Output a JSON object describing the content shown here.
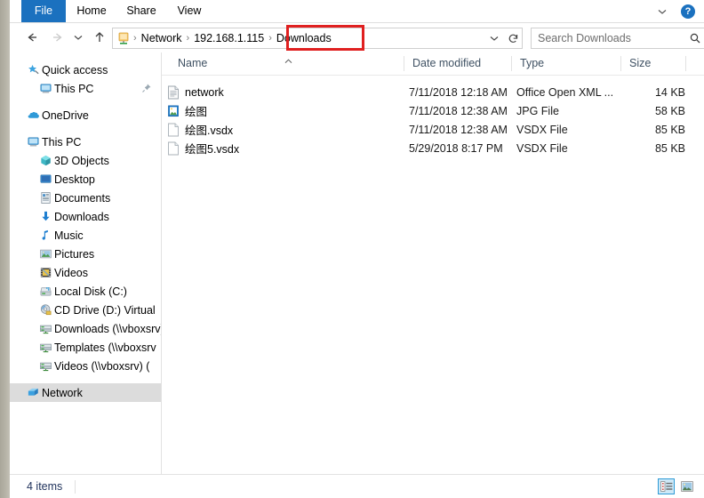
{
  "ribbon": {
    "tabs": [
      {
        "label": "File",
        "name": "tab-file"
      },
      {
        "label": "Home",
        "name": "tab-home"
      },
      {
        "label": "Share",
        "name": "tab-share"
      },
      {
        "label": "View",
        "name": "tab-view"
      }
    ],
    "minimize_icon": "chevron-down-icon",
    "help_icon": "help-question-icon",
    "help_label": "?"
  },
  "nav": {
    "back_icon": "arrow-left-icon",
    "forward_icon": "arrow-right-icon",
    "recent_icon": "chevron-down-icon",
    "up_icon": "arrow-up-icon",
    "breadcrumb_icon": "network-folder-icon",
    "breadcrumbs": [
      "Network",
      "192.168.1.115",
      "Downloads"
    ],
    "separator": "›",
    "address_dropdown_icon": "chevron-down-icon",
    "refresh_icon": "refresh-icon"
  },
  "search": {
    "placeholder": "Search Downloads",
    "value": "",
    "icon": "search-icon"
  },
  "annotation": {
    "target": "Downloads",
    "color": "#e02020"
  },
  "sidebar": {
    "items": [
      {
        "label": "Quick access",
        "icon": "star-pin-icon",
        "indent": 0,
        "selected": false,
        "pinned": false
      },
      {
        "label": "This PC",
        "icon": "monitor-icon",
        "indent": 1,
        "selected": false,
        "pinned": true
      },
      {
        "label": "OneDrive",
        "icon": "cloud-icon",
        "indent": 0,
        "selected": false,
        "pinned": false
      },
      {
        "label": "This PC",
        "icon": "monitor-icon",
        "indent": 0,
        "selected": false,
        "pinned": false
      },
      {
        "label": "3D Objects",
        "icon": "cube-icon",
        "indent": 1,
        "selected": false,
        "pinned": false
      },
      {
        "label": "Desktop",
        "icon": "desktop-icon",
        "indent": 1,
        "selected": false,
        "pinned": false
      },
      {
        "label": "Documents",
        "icon": "documents-icon",
        "indent": 1,
        "selected": false,
        "pinned": false
      },
      {
        "label": "Downloads",
        "icon": "download-arrow-icon",
        "indent": 1,
        "selected": false,
        "pinned": false
      },
      {
        "label": "Music",
        "icon": "music-note-icon",
        "indent": 1,
        "selected": false,
        "pinned": false
      },
      {
        "label": "Pictures",
        "icon": "pictures-icon",
        "indent": 1,
        "selected": false,
        "pinned": false
      },
      {
        "label": "Videos",
        "icon": "videos-film-icon",
        "indent": 1,
        "selected": false,
        "pinned": false
      },
      {
        "label": "Local Disk (C:)",
        "icon": "hard-disk-icon",
        "indent": 1,
        "selected": false,
        "pinned": false
      },
      {
        "label": "CD Drive (D:) Virtual",
        "icon": "cd-drive-icon",
        "indent": 1,
        "selected": false,
        "pinned": false
      },
      {
        "label": "Downloads (\\\\vboxsrv) (",
        "icon": "network-drive-icon",
        "indent": 1,
        "selected": false,
        "pinned": false
      },
      {
        "label": "Templates (\\\\vboxsrv",
        "icon": "network-drive-icon",
        "indent": 1,
        "selected": false,
        "pinned": false
      },
      {
        "label": "Videos (\\\\vboxsrv) (",
        "icon": "network-drive-icon",
        "indent": 1,
        "selected": false,
        "pinned": false
      },
      {
        "label": "Network",
        "icon": "network-icon",
        "indent": 0,
        "selected": true,
        "pinned": false
      }
    ]
  },
  "filelist": {
    "columns": [
      {
        "label": "Name",
        "name": "column-header-name",
        "sorted": true,
        "sort_direction": "ascending"
      },
      {
        "label": "Date modified",
        "name": "column-header-date-modified",
        "sorted": false
      },
      {
        "label": "Type",
        "name": "column-header-type",
        "sorted": false
      },
      {
        "label": "Size",
        "name": "column-header-size",
        "sorted": false
      }
    ],
    "rows": [
      {
        "name": "network",
        "icon": "document-icon",
        "date": "7/11/2018 12:18 AM",
        "type": "Office Open XML ...",
        "size": "14 KB"
      },
      {
        "name": "绘图",
        "icon": "image-file-icon",
        "date": "7/11/2018 12:38 AM",
        "type": "JPG File",
        "size": "58 KB"
      },
      {
        "name": "绘图.vsdx",
        "icon": "blank-file-icon",
        "date": "7/11/2018 12:38 AM",
        "type": "VSDX File",
        "size": "85 KB"
      },
      {
        "name": "绘图5.vsdx",
        "icon": "blank-file-icon",
        "date": "5/29/2018 8:17 PM",
        "type": "VSDX File",
        "size": "85 KB"
      }
    ]
  },
  "status": {
    "item_count": "4 items",
    "view_details_icon": "details-view-icon",
    "view_large_icons_icon": "large-icons-view-icon",
    "active_view": "details"
  }
}
